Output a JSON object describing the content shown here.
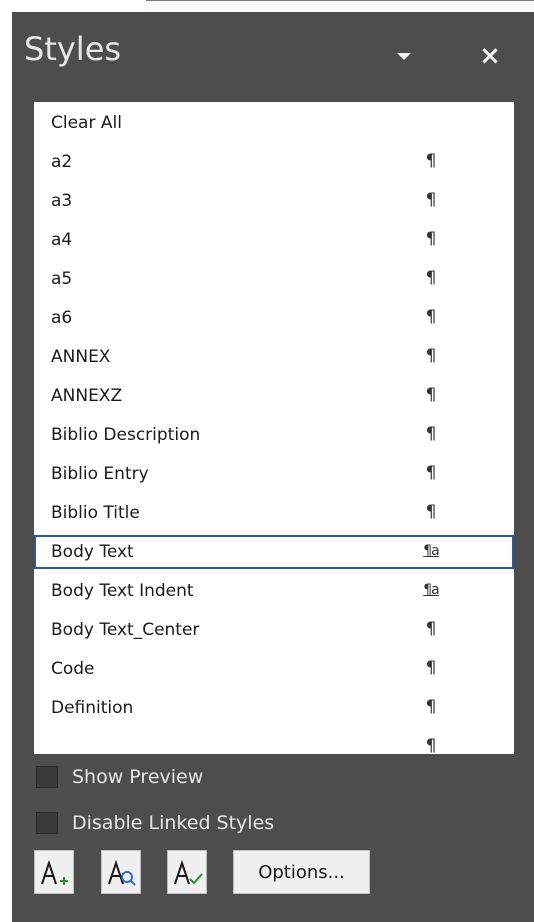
{
  "pane": {
    "title": "Styles",
    "dropdown_icon": "chevron-down-icon",
    "close_label": "×"
  },
  "styles_list": [
    {
      "name": "Clear All",
      "mark": ""
    },
    {
      "name": "a2",
      "mark": "¶"
    },
    {
      "name": "a3",
      "mark": "¶"
    },
    {
      "name": "a4",
      "mark": "¶"
    },
    {
      "name": "a5",
      "mark": "¶"
    },
    {
      "name": "a6",
      "mark": "¶"
    },
    {
      "name": "ANNEX",
      "mark": "¶"
    },
    {
      "name": "ANNEXZ",
      "mark": "¶"
    },
    {
      "name": "Biblio Description",
      "mark": "¶"
    },
    {
      "name": "Biblio Entry",
      "mark": "¶"
    },
    {
      "name": "Biblio Title",
      "mark": "¶"
    },
    {
      "name": "Body Text",
      "mark": "¶a",
      "selected": true
    },
    {
      "name": "Body Text Indent",
      "mark": "¶a"
    },
    {
      "name": "Body Text_Center",
      "mark": "¶"
    },
    {
      "name": "Code",
      "mark": "¶"
    },
    {
      "name": "Definition",
      "mark": "¶"
    }
  ],
  "options": {
    "show_preview": "Show Preview",
    "disable_linked": "Disable Linked Styles"
  },
  "toolbar": {
    "new_style_icon": "new-style-icon",
    "style_inspector_icon": "style-inspector-icon",
    "manage_styles_icon": "manage-styles-icon",
    "options_label": "Options..."
  },
  "colors": {
    "pane_bg": "#4d4d4d",
    "selection_border": "#2b579a"
  }
}
